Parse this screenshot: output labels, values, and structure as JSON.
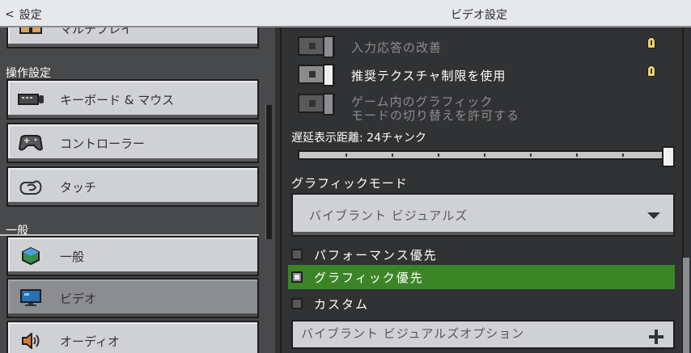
{
  "header": {
    "back_label": "設定",
    "title": "ビデオ設定"
  },
  "sidebar": {
    "top_item": "マルチプレイ",
    "section_controls": "操作設定",
    "controls_items": [
      {
        "label": "キーボード & マウス",
        "icon": "keyboard-icon"
      },
      {
        "label": "コントローラー",
        "icon": "gamepad-icon"
      },
      {
        "label": "タッチ",
        "icon": "touch-hand-icon"
      }
    ],
    "section_general": "一般",
    "general_items": [
      {
        "label": "一般",
        "icon": "globe-cube-icon"
      },
      {
        "label": "ビデオ",
        "icon": "monitor-icon",
        "selected": true
      },
      {
        "label": "オーディオ",
        "icon": "speaker-icon"
      }
    ]
  },
  "video": {
    "toggle_input_response": "入力応答の改善",
    "toggle_texture_limit": "推奨テクスチャ制限を使用",
    "toggle_ingame_graphics_line1": "ゲーム内のグラフィック",
    "toggle_ingame_graphics_line2": "モードの切り替えを許可する",
    "render_distance_label": "遅延表示距離: 24チャンク",
    "render_distance_value": 24,
    "graphics_mode_label": "グラフィックモード",
    "graphics_mode_value": "バイブラント ビジュアルズ",
    "options": [
      "パフォーマンス優先",
      "グラフィック優先",
      "カスタム"
    ],
    "selected_option": "グラフィック優先",
    "expander_label": "バイブラント ビジュアルズオプション"
  },
  "colors": {
    "accent_green": "#3c8527",
    "button_gray": "#d0d1d4",
    "bg_dark": "#313233"
  }
}
